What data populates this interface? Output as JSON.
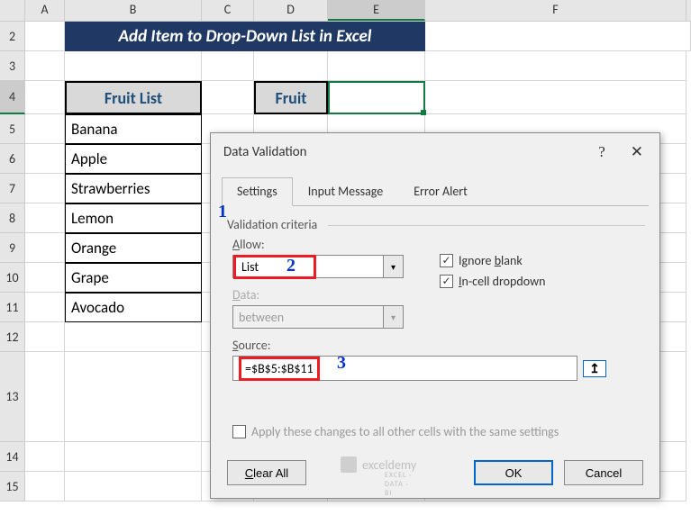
{
  "columns": {
    "A": "A",
    "B": "B",
    "C": "C",
    "D": "D",
    "E": "E",
    "F": "F"
  },
  "rows": [
    "2",
    "3",
    "4",
    "5",
    "6",
    "7",
    "8",
    "9",
    "10",
    "11",
    "12",
    "13",
    "14",
    "15"
  ],
  "title_banner": "Add Item to Drop-Down List in Excel",
  "headers": {
    "fruit_list": "Fruit List",
    "fruit": "Fruit"
  },
  "fruits": [
    "Banana",
    "Apple",
    "Strawberries",
    "Lemon",
    "Orange",
    "Grape",
    "Avocado"
  ],
  "dialog": {
    "title": "Data Validation",
    "help": "?",
    "close": "✕",
    "tabs": {
      "settings": "Settings",
      "input_msg": "Input Message",
      "error_alert": "Error Alert"
    },
    "fieldset": "Validation criteria",
    "allow_label": "Allow:",
    "allow_value": "List",
    "data_label": "Data:",
    "data_value": "between",
    "source_label": "Source:",
    "source_value": "=$B$5:$B$11",
    "ignore_blank": "Ignore blank",
    "incell_dropdown": "In-cell dropdown",
    "apply_all": "Apply these changes to all other cells with the same settings",
    "clear_all": "Clear All",
    "ok": "OK",
    "cancel": "Cancel"
  },
  "annotations": {
    "a1": "1",
    "a2": "2",
    "a3": "3"
  },
  "watermark": {
    "name": "exceldemy",
    "sub": "EXCEL · DATA · BI"
  }
}
